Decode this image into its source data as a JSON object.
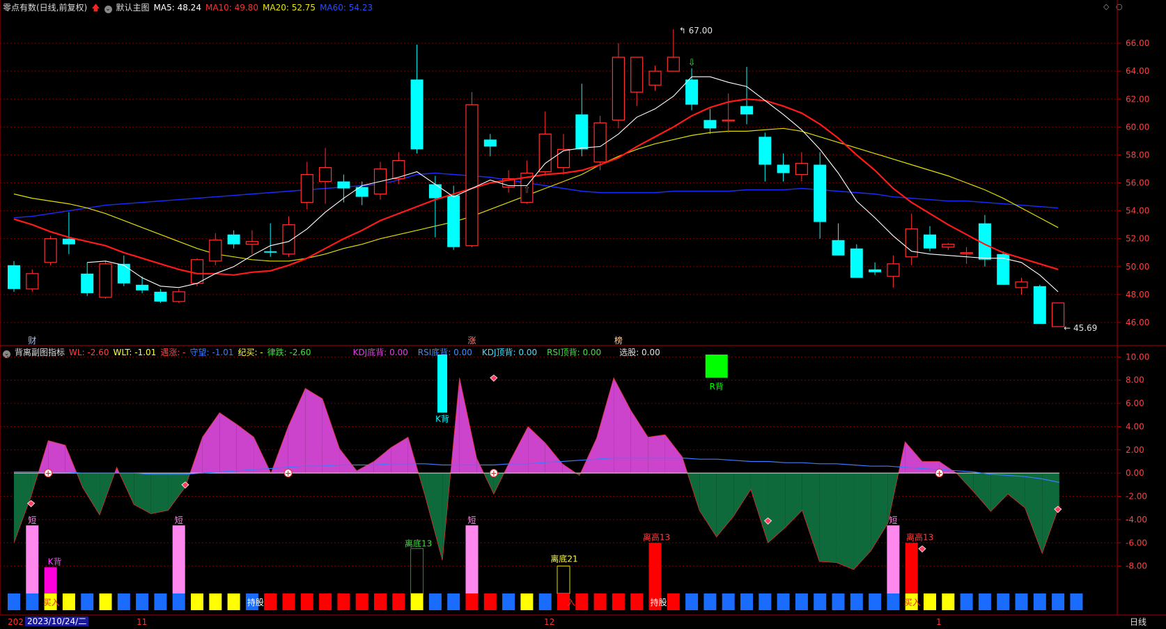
{
  "main_header": {
    "title": "零点有数(日线,前复权)",
    "template": "默认主图",
    "ma": [
      {
        "label": "MA5: 48.24",
        "color": "#ffffff"
      },
      {
        "label": "MA10: 49.80",
        "color": "#ff3030"
      },
      {
        "label": "MA20: 52.75",
        "color": "#e8e800"
      },
      {
        "label": "MA60: 54.23",
        "color": "#2a4cff"
      }
    ]
  },
  "sub_header": {
    "title": "背离副图指标",
    "items": [
      {
        "label": "WL: -2.60",
        "color": "#ff4040"
      },
      {
        "label": "WLT: -1.01",
        "color": "#ffff40"
      },
      {
        "label": "遇涨: -",
        "color": "#ff4040"
      },
      {
        "label": "守望: -1.01",
        "color": "#3a7cff"
      },
      {
        "label": "纪买: -",
        "color": "#ffff40"
      },
      {
        "label": "律跌: -2.60",
        "color": "#40e040"
      },
      {
        "label": "KDJ底背: 0.00",
        "color": "#e040e0"
      },
      {
        "label": "RSI底背: 0.00",
        "color": "#3a8cff"
      },
      {
        "label": "KDJ顶背: 0.00",
        "color": "#40e0ff"
      },
      {
        "label": "RSI顶背: 0.00",
        "color": "#40e040"
      },
      {
        "label": "选股: 0.00",
        "color": "#e0e0e0"
      }
    ]
  },
  "timeline": {
    "left_year": "202",
    "cursor_date": "2023/10/24/二",
    "month_11": "11",
    "month_12": "12",
    "month_1": "1",
    "period": "日线"
  },
  "colors": {
    "up": "#ff3030",
    "down": "#00ffff",
    "ma5": "#ffffff",
    "ma10": "#ff1a1a",
    "ma20": "#e0e000",
    "ma60": "#1a2cff",
    "grid": "#7a0000",
    "axis": "#b00000",
    "magenta_fill": "#cc44cc",
    "green_fill": "#0e6a3a"
  },
  "chart_data": [
    {
      "type": "candlestick",
      "price_ylim": [
        44.8,
        67.8
      ],
      "y_ticks": [
        "66.00",
        "64.00",
        "62.00",
        "60.00",
        "58.00",
        "56.00",
        "54.00",
        "52.00",
        "50.00",
        "48.00",
        "46.00"
      ],
      "high_annotation": "67.00",
      "low_annotation": "45.69",
      "event_labels": [
        "财",
        "涨",
        "榜"
      ],
      "candles": [
        [
          50.1,
          48.4,
          50.4,
          48.2
        ],
        [
          48.4,
          49.5,
          49.8,
          48.2
        ],
        [
          50.3,
          52.0,
          52.2,
          50.1
        ],
        [
          52.0,
          51.6,
          53.9,
          50.9
        ],
        [
          49.5,
          48.1,
          50.3,
          47.9
        ],
        [
          47.8,
          50.2,
          50.4,
          47.7
        ],
        [
          50.2,
          48.8,
          50.8,
          48.6
        ],
        [
          48.7,
          48.3,
          49.3,
          48.1
        ],
        [
          48.2,
          47.5,
          48.4,
          47.4
        ],
        [
          47.5,
          48.2,
          48.4,
          47.4
        ],
        [
          48.8,
          50.5,
          50.6,
          48.6
        ],
        [
          50.4,
          51.9,
          52.4,
          50.1
        ],
        [
          52.3,
          51.6,
          52.6,
          51.3
        ],
        [
          51.6,
          51.8,
          52.6,
          50.9
        ],
        [
          51.1,
          51.0,
          53.1,
          50.7
        ],
        [
          50.9,
          53.0,
          53.6,
          50.7
        ],
        [
          54.6,
          56.6,
          57.5,
          54.1
        ],
        [
          56.1,
          57.1,
          58.5,
          54.5
        ],
        [
          56.1,
          55.6,
          56.6,
          54.6
        ],
        [
          55.7,
          55.0,
          56.1,
          54.4
        ],
        [
          55.2,
          57.0,
          57.5,
          54.8
        ],
        [
          56.3,
          57.6,
          58.2,
          55.9
        ],
        [
          63.4,
          58.4,
          65.9,
          58.1
        ],
        [
          55.9,
          54.9,
          56.5,
          52.1
        ],
        [
          55.1,
          51.4,
          55.8,
          51.2
        ],
        [
          51.5,
          61.6,
          62.5,
          51.4
        ],
        [
          59.1,
          58.6,
          59.5,
          57.9
        ],
        [
          55.7,
          56.3,
          56.9,
          55.3
        ],
        [
          54.6,
          56.7,
          57.6,
          54.5
        ],
        [
          56.8,
          59.5,
          61.1,
          56.5
        ],
        [
          57.1,
          58.4,
          59.5,
          56.6
        ],
        [
          60.9,
          58.4,
          63.1,
          57.9
        ],
        [
          57.5,
          60.3,
          60.8,
          56.9
        ],
        [
          60.5,
          65.0,
          66.0,
          59.9
        ],
        [
          62.5,
          65.0,
          65.0,
          61.5
        ],
        [
          63.0,
          64.0,
          64.4,
          62.6
        ],
        [
          64.0,
          65.0,
          67.0,
          64.0
        ],
        [
          63.4,
          61.6,
          64.2,
          61.2
        ],
        [
          60.5,
          59.9,
          61.3,
          59.5
        ],
        [
          60.5,
          60.5,
          62.4,
          59.6
        ],
        [
          61.5,
          60.9,
          64.3,
          60.2
        ],
        [
          59.3,
          57.3,
          59.6,
          56.1
        ],
        [
          57.3,
          56.7,
          58.1,
          56.1
        ],
        [
          56.6,
          57.4,
          58.2,
          56.1
        ],
        [
          57.3,
          53.2,
          58.2,
          52.0
        ],
        [
          51.9,
          50.8,
          53.1,
          50.8
        ],
        [
          51.3,
          49.2,
          51.6,
          49.4
        ],
        [
          49.8,
          49.6,
          50.3,
          49.4
        ],
        [
          49.3,
          50.2,
          50.8,
          48.5
        ],
        [
          50.7,
          52.7,
          53.8,
          50.1
        ],
        [
          52.3,
          51.3,
          52.9,
          51.1
        ],
        [
          51.4,
          51.6,
          51.7,
          51.2
        ],
        [
          51.0,
          51.0,
          51.4,
          50.2
        ],
        [
          53.1,
          50.5,
          53.7,
          50.0
        ],
        [
          50.9,
          48.7,
          51.1,
          48.7
        ],
        [
          48.5,
          48.9,
          49.2,
          48.0
        ],
        [
          48.6,
          45.9,
          48.7,
          45.9
        ],
        [
          45.7,
          47.4,
          47.4,
          45.7
        ]
      ],
      "ma5": [
        null,
        null,
        null,
        null,
        50.3,
        50.4,
        50.1,
        49.2,
        48.6,
        48.5,
        48.8,
        49.5,
        50.0,
        50.8,
        51.5,
        51.8,
        52.7,
        53.9,
        54.9,
        55.8,
        56.1,
        56.4,
        56.8,
        55.9,
        55.0,
        55.6,
        56.2,
        55.8,
        55.8,
        57.4,
        58.3,
        58.5,
        58.6,
        59.5,
        60.7,
        61.3,
        62.2,
        63.6,
        63.6,
        63.2,
        62.9,
        61.9,
        60.9,
        59.8,
        58.4,
        56.7,
        54.7,
        53.5,
        52.2,
        51.1,
        50.9,
        50.8,
        50.7,
        50.6,
        50.6,
        50.3,
        49.4,
        48.2
      ],
      "ma10": [
        53.4,
        53.0,
        52.5,
        52.1,
        51.8,
        51.5,
        51.0,
        50.6,
        50.2,
        49.8,
        49.5,
        49.5,
        49.4,
        49.6,
        49.7,
        50.1,
        50.6,
        51.3,
        52.0,
        52.6,
        53.3,
        53.8,
        54.3,
        54.8,
        55.2,
        55.6,
        56.0,
        56.2,
        56.4,
        56.6,
        56.7,
        56.9,
        57.3,
        57.8,
        58.6,
        59.3,
        60.0,
        60.8,
        61.4,
        61.8,
        62.0,
        61.9,
        61.5,
        61.0,
        60.2,
        59.2,
        58.0,
        56.9,
        55.6,
        54.6,
        53.8,
        53.0,
        52.3,
        51.6,
        51.0,
        50.6,
        50.2,
        49.8
      ],
      "ma20": [
        55.2,
        54.9,
        54.7,
        54.5,
        54.2,
        53.8,
        53.3,
        52.8,
        52.3,
        51.8,
        51.3,
        50.9,
        50.7,
        50.5,
        50.4,
        50.4,
        50.6,
        50.9,
        51.3,
        51.6,
        52.0,
        52.3,
        52.6,
        52.9,
        53.2,
        53.6,
        54.1,
        54.6,
        55.1,
        55.6,
        56.1,
        56.6,
        57.3,
        57.9,
        58.4,
        58.8,
        59.1,
        59.4,
        59.6,
        59.7,
        59.7,
        59.8,
        59.9,
        59.7,
        59.3,
        58.9,
        58.5,
        58.1,
        57.7,
        57.3,
        56.9,
        56.5,
        56.0,
        55.5,
        54.9,
        54.2,
        53.5,
        52.8
      ],
      "ma60": [
        53.5,
        53.6,
        53.8,
        54.0,
        54.2,
        54.4,
        54.5,
        54.6,
        54.7,
        54.8,
        54.9,
        55.0,
        55.1,
        55.2,
        55.3,
        55.4,
        55.5,
        55.6,
        55.7,
        55.8,
        55.9,
        56.2,
        56.6,
        56.7,
        56.6,
        56.5,
        56.4,
        56.2,
        56.0,
        55.8,
        55.6,
        55.4,
        55.3,
        55.3,
        55.3,
        55.3,
        55.4,
        55.4,
        55.4,
        55.4,
        55.5,
        55.5,
        55.5,
        55.6,
        55.5,
        55.4,
        55.3,
        55.2,
        55.0,
        54.9,
        54.8,
        54.7,
        54.7,
        54.6,
        54.5,
        54.4,
        54.3,
        54.2
      ]
    },
    {
      "type": "area",
      "name_label": "背离副图指标",
      "ylim": [
        -10.0,
        10.5
      ],
      "y_ticks": [
        "10.00",
        "8.00",
        "6.00",
        "4.00",
        "2.00",
        "0.00",
        "-2.00",
        "-4.00",
        "-6.00",
        "-8.00"
      ],
      "wl": [
        -6.0,
        -2.0,
        2.8,
        2.4,
        -1.2,
        -3.6,
        0.5,
        -2.7,
        -3.5,
        -3.2,
        -1.2,
        3.1,
        5.2,
        4.2,
        3.1,
        0.0,
        4.0,
        7.3,
        6.4,
        2.1,
        0.2,
        1.0,
        2.2,
        3.1,
        -2.0,
        -7.5,
        8.2,
        1.3,
        -1.8,
        1.2,
        4.0,
        2.6,
        0.8,
        -0.2,
        3.0,
        8.2,
        5.4,
        3.1,
        3.3,
        1.4,
        -3.2,
        -5.5,
        -3.7,
        -1.4,
        -6.0,
        -4.7,
        -3.2,
        -7.6,
        -7.7,
        -8.3,
        -6.7,
        -4.3,
        2.7,
        1.0,
        1.0,
        0.0,
        -1.6,
        -3.3,
        -1.8,
        -3.0,
        -6.9,
        -2.8
      ],
      "wlt": [
        0.1,
        0.1,
        0.1,
        0.1,
        0.0,
        0.0,
        0.0,
        0.0,
        -0.1,
        -0.1,
        -0.1,
        0.0,
        0.1,
        0.2,
        0.3,
        0.4,
        0.5,
        0.6,
        0.6,
        0.7,
        0.7,
        0.7,
        0.8,
        0.8,
        0.8,
        0.7,
        0.7,
        0.7,
        0.7,
        0.8,
        0.8,
        0.9,
        1.0,
        1.1,
        1.2,
        1.3,
        1.3,
        1.3,
        1.3,
        1.3,
        1.2,
        1.2,
        1.1,
        1.0,
        1.0,
        0.9,
        0.9,
        0.8,
        0.8,
        0.7,
        0.6,
        0.6,
        0.5,
        0.4,
        0.3,
        0.2,
        0.1,
        -0.1,
        -0.2,
        -0.3,
        -0.5,
        -0.8
      ],
      "signal_labels": {
        "short": "短",
        "k_div": "K背",
        "r_div": "R背",
        "buy": "买入",
        "hold": "持股",
        "leave_bottom_13": "离底13",
        "leave_bottom_21": "离底21",
        "leave_top_13": "离高13",
        "buy_tail": "入"
      },
      "signal_strip": [
        "b",
        "b",
        "y",
        "y",
        "b",
        "y",
        "b",
        "b",
        "b",
        "b",
        "y",
        "y",
        "y",
        "b",
        "r",
        "r",
        "r",
        "r",
        "r",
        "r",
        "r",
        "r",
        "y",
        "b",
        "b",
        "r",
        "r",
        "b",
        "y",
        "b",
        "r",
        "r",
        "r",
        "r",
        "r",
        "r",
        "r",
        "b",
        "b",
        "b",
        "b",
        "b",
        "b",
        "b",
        "b",
        "b",
        "b",
        "b",
        "b",
        "y",
        "y",
        "y",
        "b",
        "b",
        "b",
        "b",
        "b",
        "b",
        "b"
      ]
    }
  ]
}
